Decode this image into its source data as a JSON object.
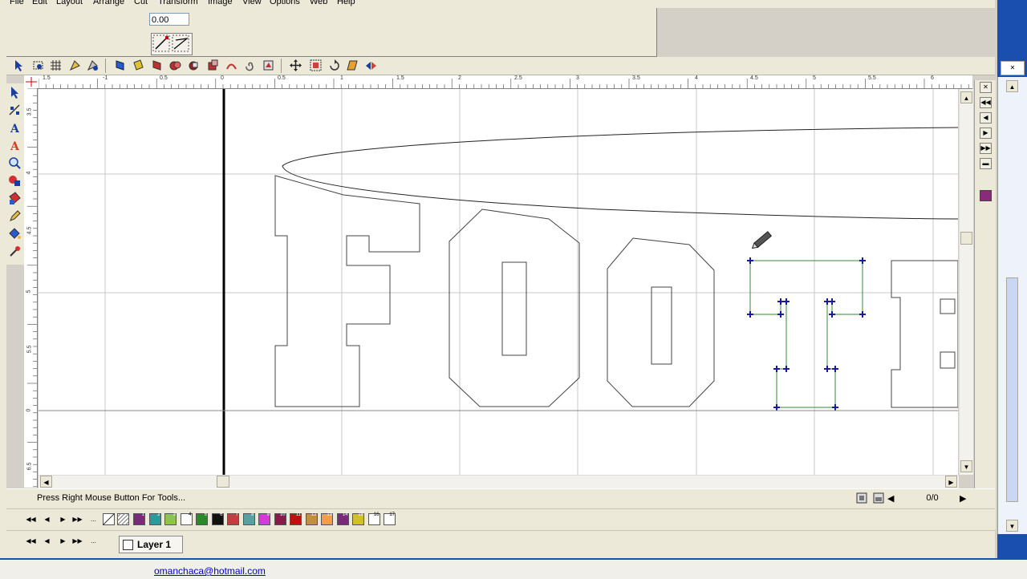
{
  "menu": [
    "File",
    "Edit",
    "Layout",
    "Arrange",
    "Cut",
    "Transform",
    "Image",
    "View",
    "Options",
    "Web",
    "Help"
  ],
  "property_bar": {
    "coordinate_value": "0.00"
  },
  "hruler_labels": [
    "1.5",
    "-1",
    "0.5",
    "0",
    "0.5",
    "1",
    "1.5",
    "2",
    "2.5",
    "3",
    "3.5",
    "4",
    "4.5",
    "5",
    "5.5",
    "6"
  ],
  "vruler_labels": [
    "3.5",
    "4",
    "4.5",
    "5",
    "5.5",
    "0",
    "6.5"
  ],
  "status": {
    "hint": "Press Right Mouse Button For Tools...",
    "page_counter": "0/0"
  },
  "layer": {
    "label": "Layer 1"
  },
  "palette": {
    "swatch_colors": [
      "#7a2a7a",
      "#2a9a9a",
      "#8fc44a",
      "#ffffff",
      "#2a8a2a",
      "#111111",
      "#c04040",
      "#5aa0a0",
      "#d63ad6",
      "#8a1a4a",
      "#c01010",
      "#c09040",
      "#f0a040",
      "#7a2a7a",
      "#d0c030",
      "#ffffff",
      "#ffffff"
    ],
    "swatch_numbers": [
      "1",
      "2",
      "3",
      "4",
      "5",
      "6",
      "7",
      "8",
      "9",
      "10",
      "11",
      "12",
      "13",
      "14",
      "15",
      "16",
      "17",
      "18"
    ]
  },
  "footer": {
    "email": "omanchaca@hotmail.com"
  }
}
